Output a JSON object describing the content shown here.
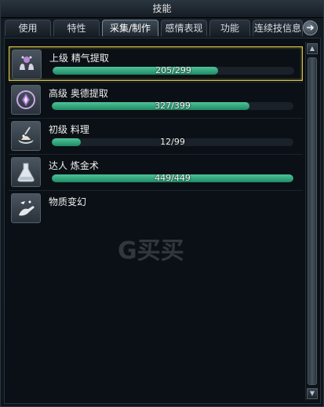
{
  "window": {
    "title": "技能"
  },
  "tabs": [
    {
      "label": "使用"
    },
    {
      "label": "特性"
    },
    {
      "label": "采集/制作",
      "active": true
    },
    {
      "label": "感情表现"
    },
    {
      "label": "功能"
    },
    {
      "label": "连续技信息"
    }
  ],
  "skills": [
    {
      "name": "上级 精气提取",
      "current": 205,
      "max": 299,
      "progress_text": "205/299",
      "icon": "essence-extraction-icon",
      "selected": true
    },
    {
      "name": "高级 奥德提取",
      "current": 327,
      "max": 399,
      "progress_text": "327/399",
      "icon": "aether-extraction-icon"
    },
    {
      "name": "初级 料理",
      "current": 12,
      "max": 99,
      "progress_text": "12/99",
      "icon": "cooking-icon"
    },
    {
      "name": "达人 炼金术",
      "current": 449,
      "max": 449,
      "progress_text": "449/449",
      "icon": "alchemy-icon"
    },
    {
      "name": "物质变幻",
      "icon": "morph-substance-icon"
    }
  ],
  "watermark": {
    "text": "G买买"
  },
  "colors": {
    "progress_fill": "#2fa57a",
    "selected_border": "#d6c34a",
    "active_tab_border": "#7b8a98"
  }
}
